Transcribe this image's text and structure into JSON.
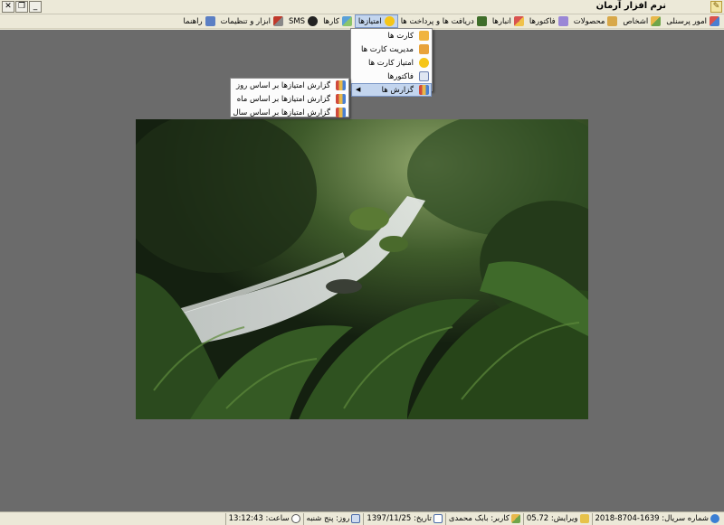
{
  "window": {
    "title": "نرم افزار آرمان"
  },
  "menubar": {
    "items": [
      {
        "label": "امور پرسنلی",
        "icon": "personnel-icon"
      },
      {
        "label": "اشخاص",
        "icon": "people-icon"
      },
      {
        "label": "محصولات",
        "icon": "products-icon"
      },
      {
        "label": "فاکتورها",
        "icon": "invoices-icon"
      },
      {
        "label": "انبارها",
        "icon": "warehouse-icon"
      },
      {
        "label": "دریافت ها و پرداخت ها",
        "icon": "payments-icon"
      },
      {
        "label": "امتیازها",
        "icon": "star-icon"
      },
      {
        "label": "کارها",
        "icon": "tasks-icon"
      },
      {
        "label": "SMS",
        "icon": "sms-icon"
      },
      {
        "label": "ابزار و تنظیمات",
        "icon": "tools-icon"
      },
      {
        "label": "راهنما",
        "icon": "help-icon"
      }
    ]
  },
  "points_menu": {
    "items": [
      {
        "label": "کارت ها",
        "icon": "card-icon"
      },
      {
        "label": "مدیریت کارت ها",
        "icon": "manage-cards-icon"
      },
      {
        "label": "امتیاز کارت ها",
        "icon": "star-icon"
      },
      {
        "label": "فاکتورها",
        "icon": "invoice-icon"
      },
      {
        "label": "گزارش ها",
        "icon": "report-icon",
        "has_submenu": true
      }
    ]
  },
  "reports_submenu": {
    "items": [
      {
        "label": "گزارش امتیازها بر اساس روز",
        "icon": "report-icon"
      },
      {
        "label": "گزارش امتیازها بر اساس ماه",
        "icon": "report-icon"
      },
      {
        "label": "گزارش امتیازها بر اساس سال",
        "icon": "report-icon"
      }
    ]
  },
  "statusbar": {
    "serial": "شماره سریال: 1639-8704-2018",
    "version": "ویرایش: 05.72",
    "user": "کاربر: بابک محمدی",
    "date": "تاریخ: 1397/11/25",
    "day": "روز: پنج شنبه",
    "time": "ساعت: 13:12:43"
  },
  "colors": {
    "workspace": "#6b6b6b",
    "menu_highlight": "#c3d5ee",
    "chrome": "#ece9d8"
  }
}
